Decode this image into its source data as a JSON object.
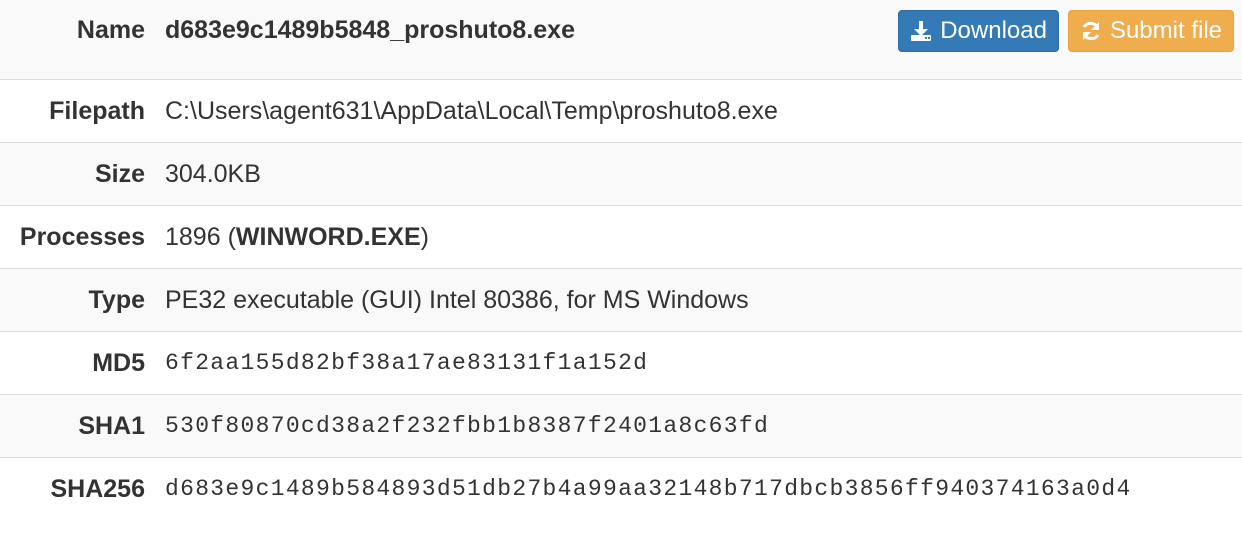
{
  "rows": {
    "name": {
      "label": "Name",
      "value": "d683e9c1489b5848_proshuto8.exe"
    },
    "filepath": {
      "label": "Filepath",
      "value": "C:\\Users\\agent631\\AppData\\Local\\Temp\\proshuto8.exe"
    },
    "size": {
      "label": "Size",
      "value": "304.0KB"
    },
    "processes": {
      "label": "Processes",
      "pid": "1896",
      "open": " (",
      "process_name": "WINWORD.EXE",
      "close": ")"
    },
    "type": {
      "label": "Type",
      "value": "PE32 executable (GUI) Intel 80386, for MS Windows"
    },
    "md5": {
      "label": "MD5",
      "value": "6f2aa155d82bf38a17ae83131f1a152d"
    },
    "sha1": {
      "label": "SHA1",
      "value": "530f80870cd38a2f232fbb1b8387f2401a8c63fd"
    },
    "sha256": {
      "label": "SHA256",
      "value": "d683e9c1489b584893d51db27b4a99aa32148b717dbcb3856ff940374163a0d4"
    }
  },
  "buttons": {
    "download": {
      "label": "Download",
      "icon": "download-icon",
      "color": "#337ab7"
    },
    "submit": {
      "label": "Submit file",
      "icon": "refresh-icon",
      "color": "#f0ad4e"
    }
  }
}
